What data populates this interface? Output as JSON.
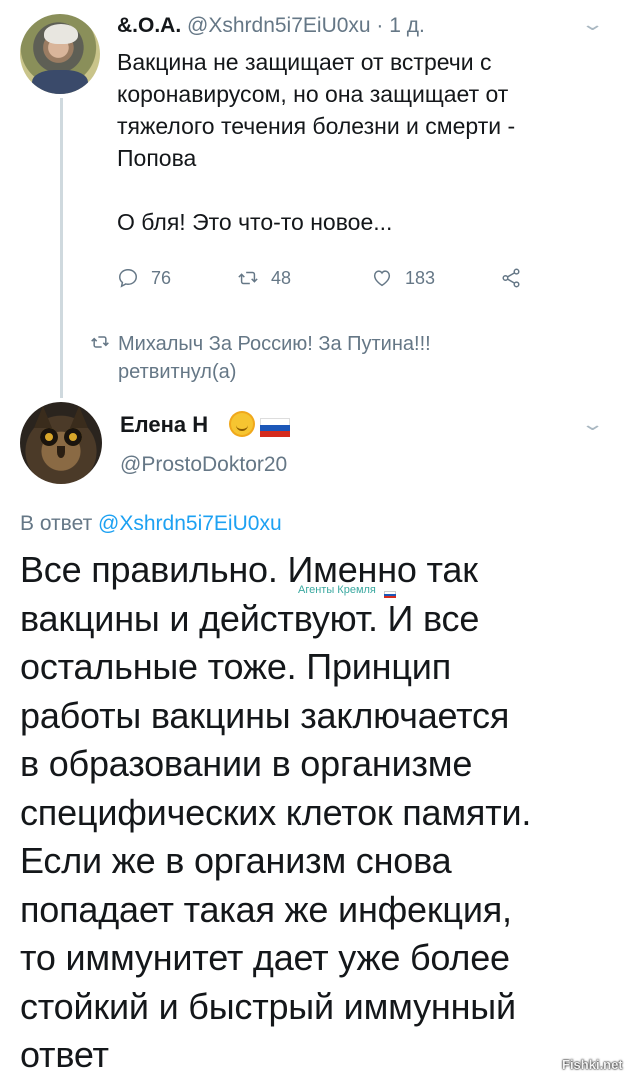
{
  "tweet1": {
    "name": "&.O.A.",
    "handle": "@Xshrdn5i7EiU0xu",
    "separator": " · ",
    "time": "1 д.",
    "text": "Вакцина не защищает от встречи с\nкоронавирусом, но она защищает от\nтяжелого течения болезни и смерти -\nПопова\n\nО бля! Это что-то новое...",
    "replies": "76",
    "retweets": "48",
    "likes": "183",
    "icons": [
      "reply-icon",
      "retweet-icon",
      "like-icon",
      "share-icon",
      "chevron-down-icon"
    ]
  },
  "retweet_notice": {
    "text": "Михалыч За Россию! За Путина!!!\nретвитнул(а)",
    "icon": "retweet-icon"
  },
  "tweet2": {
    "name": "Елена Н",
    "handle": "@ProstoDoktor20",
    "reply_prefix": "В ответ ",
    "reply_handle": "@Xshrdn5i7EiU0xu",
    "text": "Все правильно. Именно так\nвакцины и действуют. И все\nостальные тоже. Принцип\nработы вакцины заключается\nв образовании в организме\nспецифических клеток памяти.\nЕсли же в организм снова\nпопадает такая же инфекция,\nто иммунитет дает уже более\nстойкий и быстрый иммунный\nответ",
    "emojis": [
      "sun-face-icon",
      "russia-flag-icon"
    ]
  },
  "overlay": {
    "small_caption": "Агенты Кремля",
    "watermark": "Fishki.net"
  },
  "colors": {
    "text": "#14171a",
    "muted": "#657786",
    "link": "#1da1f2",
    "thread_line": "#cfd9de",
    "caption": "#3aa8a0"
  }
}
